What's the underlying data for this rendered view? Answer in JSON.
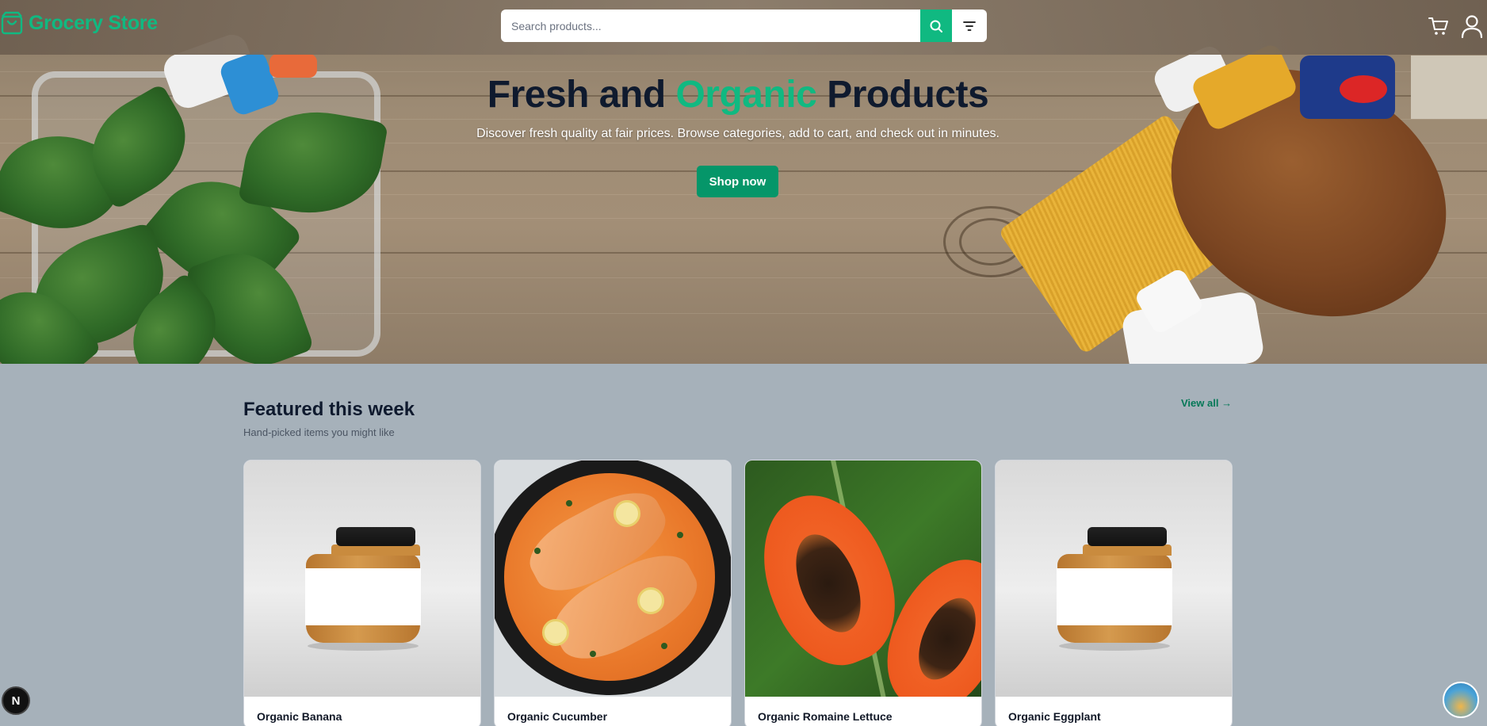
{
  "header": {
    "brand": "Grocery Store",
    "search_placeholder": "Search products..."
  },
  "hero": {
    "title_part1": "Fresh and ",
    "title_accent": "Organic",
    "title_part2": " Products",
    "subtitle": "Discover fresh quality at fair prices. Browse categories, add to cart, and check out in minutes.",
    "cta": "Shop now"
  },
  "featured": {
    "title": "Featured this week",
    "subtitle": "Hand-picked items you might like",
    "view_all": "View all →",
    "products": [
      {
        "name": "Organic Banana"
      },
      {
        "name": "Organic Cucumber"
      },
      {
        "name": "Organic Romaine Lettuce"
      },
      {
        "name": "Organic Eggplant"
      }
    ]
  },
  "widgets": {
    "dev_badge": "N"
  },
  "colors": {
    "accent": "#10b981",
    "cta": "#059669",
    "page_bg": "#a6b1ba",
    "title": "#0f1a2e"
  }
}
